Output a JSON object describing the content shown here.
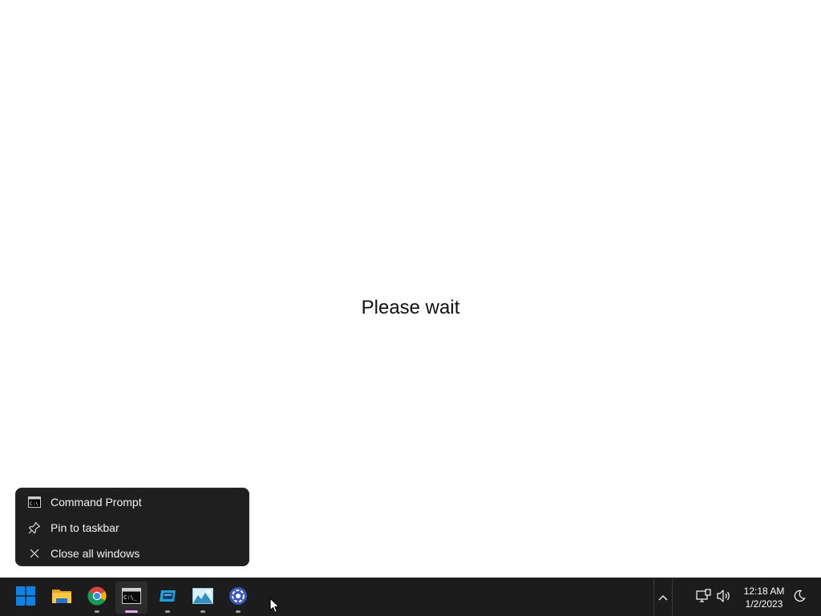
{
  "desktop": {
    "message": "Please wait"
  },
  "jumplist": {
    "items": [
      {
        "label": "Command Prompt",
        "icon": "command-prompt-icon"
      },
      {
        "label": "Pin to taskbar",
        "icon": "pin-icon"
      },
      {
        "label": "Close all windows",
        "icon": "close-icon"
      }
    ]
  },
  "taskbar": {
    "apps": [
      {
        "name": "start",
        "icon": "windows-logo-icon"
      },
      {
        "name": "file-explorer",
        "icon": "folder-icon"
      },
      {
        "name": "chrome",
        "icon": "chrome-icon"
      },
      {
        "name": "command-prompt",
        "icon": "terminal-icon",
        "active": true
      },
      {
        "name": "app-blue",
        "icon": "app-icon"
      },
      {
        "name": "image-viewer",
        "icon": "image-icon"
      },
      {
        "name": "app-gear",
        "icon": "settings-globe-icon"
      }
    ],
    "tray": {
      "clock_time": "12:18 AM",
      "clock_date": "1/2/2023"
    }
  },
  "colors": {
    "taskbar_bg": "#1c1c1c",
    "menu_bg": "#1f1f1f",
    "active_indicator": "#e3a8f0",
    "windows_blue": "#0a84e8"
  }
}
